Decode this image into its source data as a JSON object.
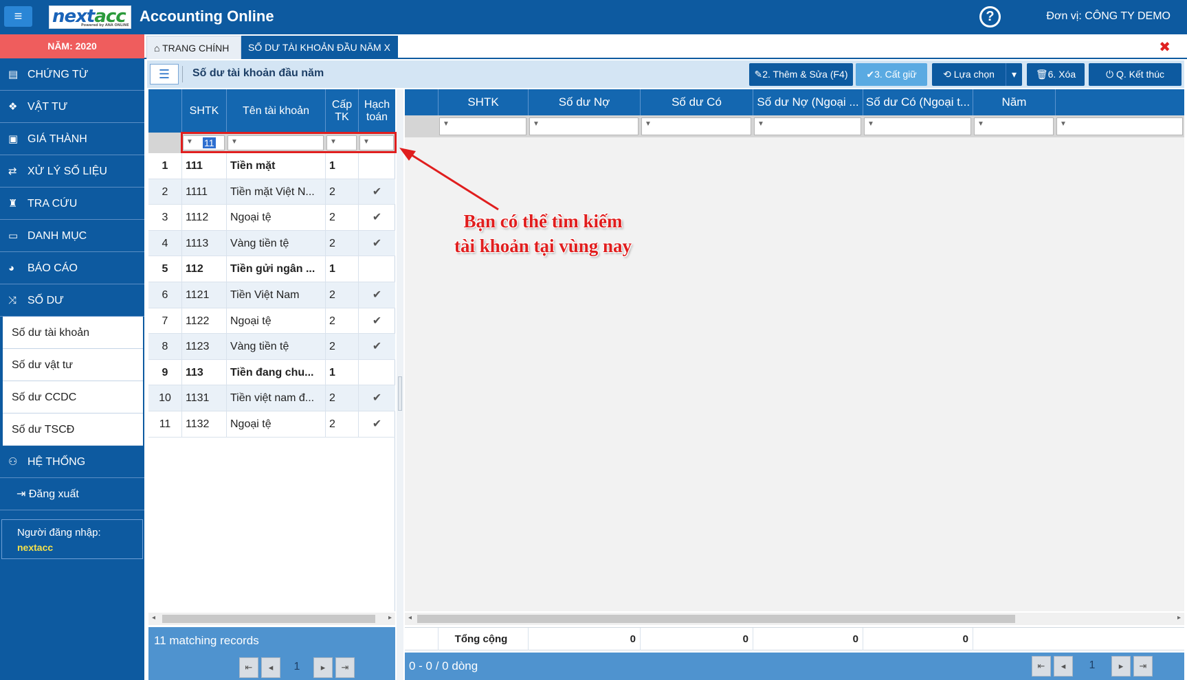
{
  "header": {
    "menu_icon": "hamburger-icon",
    "logo_main": "next",
    "logo_accent": "acc",
    "logo_tag": "Powered by ANA ONLINE",
    "app_title": "Accounting Online",
    "help_label": "?",
    "org_label": "Đơn vị: CÔNG TY DEMO"
  },
  "sidebar": {
    "year": "NĂM: 2020",
    "items": [
      {
        "label": "CHỨNG TỪ",
        "icon": "list-icon"
      },
      {
        "label": "VẬT TƯ",
        "icon": "cubes-icon"
      },
      {
        "label": "GIÁ THÀNH",
        "icon": "money-icon"
      },
      {
        "label": "XỬ LÝ SỐ LIỆU",
        "icon": "exchange-icon"
      },
      {
        "label": "TRA CỨU",
        "icon": "binoculars-icon"
      },
      {
        "label": "DANH MỤC",
        "icon": "card-icon"
      },
      {
        "label": "BÁO CÁO",
        "icon": "pie-chart-icon"
      },
      {
        "label": "SỐ DƯ",
        "icon": "shuffle-icon"
      }
    ],
    "sub_items": [
      "Số dư tài khoản",
      "Số dư vật tư",
      "Số dư CCDC",
      "Số dư TSCĐ"
    ],
    "system_label": "HỆ THỐNG",
    "logout_label": "Đăng xuất",
    "login_label": "Người đăng nhập:",
    "login_user": "nextacc"
  },
  "tabs": {
    "home_label": "TRANG CHÍNH",
    "active_label": "SỐ DƯ TÀI KHOẢN ĐẦU NĂM X",
    "close_label": "✖"
  },
  "toolbar": {
    "title": "Số dư tài khoản đầu năm",
    "add_edit": "2. Thêm & Sửa (F4)",
    "save": "3. Cất giữ",
    "options": "Lựa chọn",
    "delete": "6. Xóa",
    "finish": "Q. Kết thúc"
  },
  "left_grid": {
    "headers": [
      "SHTK",
      "Tên tài khoản",
      "Cấp TK",
      "Hạch toán"
    ],
    "filter_value": "11",
    "rows": [
      {
        "no": "1",
        "shtk": "111",
        "name": "Tiền mặt",
        "level": "1",
        "posted": "",
        "bold": true
      },
      {
        "no": "2",
        "shtk": "1111",
        "name": "Tiền mặt Việt N...",
        "level": "2",
        "posted": "✔",
        "bold": false
      },
      {
        "no": "3",
        "shtk": "1112",
        "name": "Ngoại tệ",
        "level": "2",
        "posted": "✔",
        "bold": false
      },
      {
        "no": "4",
        "shtk": "1113",
        "name": "Vàng tiền tệ",
        "level": "2",
        "posted": "✔",
        "bold": false
      },
      {
        "no": "5",
        "shtk": "112",
        "name": "Tiền gửi ngân ...",
        "level": "1",
        "posted": "",
        "bold": true
      },
      {
        "no": "6",
        "shtk": "1121",
        "name": "Tiền Việt Nam",
        "level": "2",
        "posted": "✔",
        "bold": false
      },
      {
        "no": "7",
        "shtk": "1122",
        "name": "Ngoại tệ",
        "level": "2",
        "posted": "✔",
        "bold": false
      },
      {
        "no": "8",
        "shtk": "1123",
        "name": "Vàng tiền tệ",
        "level": "2",
        "posted": "✔",
        "bold": false
      },
      {
        "no": "9",
        "shtk": "113",
        "name": "Tiền đang chu...",
        "level": "1",
        "posted": "",
        "bold": true
      },
      {
        "no": "10",
        "shtk": "1131",
        "name": "Tiền việt nam đ...",
        "level": "2",
        "posted": "✔",
        "bold": false
      },
      {
        "no": "11",
        "shtk": "1132",
        "name": "Ngoại tệ",
        "level": "2",
        "posted": "✔",
        "bold": false
      }
    ],
    "matching": "11 matching records",
    "page": "1"
  },
  "right_grid": {
    "headers": [
      "SHTK",
      "Số dư Nợ",
      "Số dư Có",
      "Số dư Nợ (Ngoại ...",
      "Số dư Có (Ngoại t...",
      "Năm"
    ],
    "total_label": "Tổng cộng",
    "totals": [
      "0",
      "0",
      "0",
      "0"
    ],
    "range": "0 - 0 / 0 dòng",
    "page": "1"
  },
  "annotation": {
    "line1": "Bạn có thể tìm kiếm",
    "line2": "tài khoản tại vùng nay"
  },
  "colors": {
    "primary": "#0d5aa0",
    "header": "#1467b0",
    "year_bar": "#ef5d5d",
    "annotation": "#e01e1e"
  }
}
